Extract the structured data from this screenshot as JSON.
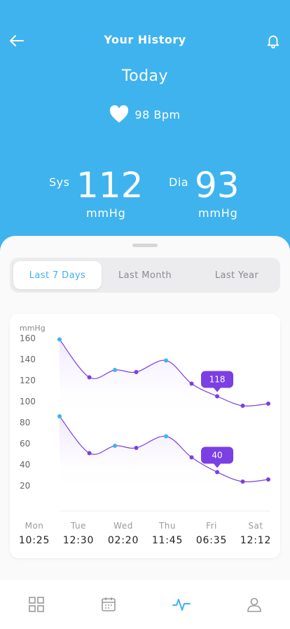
{
  "header": {
    "title": "Your History"
  },
  "summary": {
    "period": "Today",
    "heart_rate": "98 Bpm",
    "sys": {
      "label": "Sys",
      "value": "112",
      "unit": "mmHg"
    },
    "dia": {
      "label": "Dia",
      "value": "93",
      "unit": "mmHg"
    }
  },
  "range_tabs": [
    {
      "label": "Last 7 Days",
      "active": true
    },
    {
      "label": "Last Month",
      "active": false
    },
    {
      "label": "Last Year",
      "active": false
    }
  ],
  "chart_data": {
    "type": "line",
    "ylabel": "mmHg",
    "yticks": [
      160,
      140,
      120,
      100,
      80,
      60,
      40,
      20
    ],
    "ylim": [
      10,
      170
    ],
    "categories": [
      "Mon",
      "Tue",
      "Wed",
      "Thu",
      "Fri",
      "Sat"
    ],
    "times": [
      "10:25",
      "12:30",
      "02:20",
      "11:45",
      "06:35",
      "12:12"
    ],
    "x": [
      0,
      0.7,
      1.3,
      1.8,
      2.5,
      3.1,
      3.7,
      4.3,
      4.9
    ],
    "series": [
      {
        "values": [
          159,
          123,
          130,
          128,
          139,
          117,
          105,
          96,
          98
        ],
        "callout_index": 6,
        "callout": "118"
      },
      {
        "values": [
          86,
          51,
          58,
          56,
          67,
          47,
          33,
          24,
          26
        ],
        "callout_index": 6,
        "callout": "40"
      }
    ],
    "highlight_points": [
      0,
      2,
      4
    ],
    "colors": {
      "line": "#7b3fe4",
      "highlight": "#3fb3ee",
      "callout": "#7b3fe4",
      "fill": "#efe6ff"
    },
    "grid": false
  },
  "nav": [
    "grid-icon",
    "calendar-icon",
    "heart-pulse-icon",
    "user-icon"
  ],
  "colors": {
    "accent": "#3fb3ee",
    "purple": "#7b3fe4"
  }
}
